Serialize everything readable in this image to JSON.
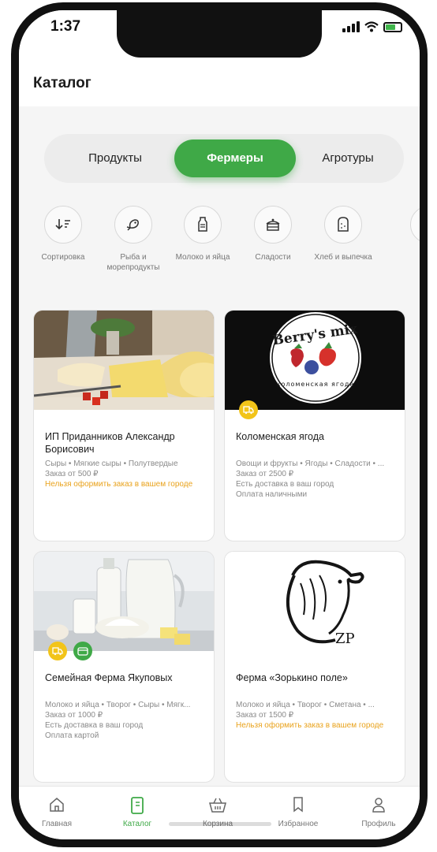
{
  "status": {
    "time": "1:37"
  },
  "header": {
    "title": "Каталог"
  },
  "segments": [
    {
      "label": "Продукты",
      "active": false
    },
    {
      "label": "Фермеры",
      "active": true
    },
    {
      "label": "Агротуры",
      "active": false
    }
  ],
  "categories": [
    {
      "label": "Сортировка",
      "icon": "sort-icon"
    },
    {
      "label": "Рыба и морепродукты",
      "icon": "fish-icon"
    },
    {
      "label": "Молоко и яйца",
      "icon": "milk-icon"
    },
    {
      "label": "Сладости",
      "icon": "cake-icon"
    },
    {
      "label": "Хлеб и выпечка",
      "icon": "bread-icon"
    }
  ],
  "farms": [
    {
      "name": "ИП Приданников Александр Борисович",
      "tags": "Сыры • Мягкие сыры • Полутвердые",
      "min_order": "Заказ от 500 ₽",
      "delivery": "Нельзя оформить заказ в вашем городе",
      "payment": ""
    },
    {
      "name": "Коломенская ягода",
      "tags": "Овощи и фрукты • Ягоды • Сладости • ...",
      "min_order": "Заказ от 2500 ₽",
      "delivery": "Есть доставка в ваш город",
      "payment": "Оплата наличными",
      "logo_text_top": "Berry's mix",
      "logo_text_bottom": "коломенская ягода"
    },
    {
      "name": "Семейная Ферма Якуповых",
      "tags": "Молоко и яйца • Творог • Сыры • Мягк...",
      "min_order": "Заказ от 1000 ₽",
      "delivery": "Есть доставка в ваш город",
      "payment": "Оплата картой"
    },
    {
      "name": "Ферма «Зорькино поле»",
      "tags": "Молоко и яйца • Творог • Сметана • ...",
      "min_order": "Заказ от 1500 ₽",
      "delivery": "Нельзя оформить заказ в вашем городе",
      "payment": "",
      "logo_text": "ZP"
    }
  ],
  "tabbar": [
    {
      "label": "Главная",
      "icon": "home-icon",
      "active": false
    },
    {
      "label": "Каталог",
      "icon": "catalog-icon",
      "active": true
    },
    {
      "label": "Корзина",
      "icon": "basket-icon",
      "active": false
    },
    {
      "label": "Избранное",
      "icon": "bookmark-icon",
      "active": false
    },
    {
      "label": "Профиль",
      "icon": "profile-icon",
      "active": false
    }
  ],
  "colors": {
    "accent": "#3fa947",
    "warning": "#e9a21b",
    "badge_yellow": "#f2c419"
  }
}
